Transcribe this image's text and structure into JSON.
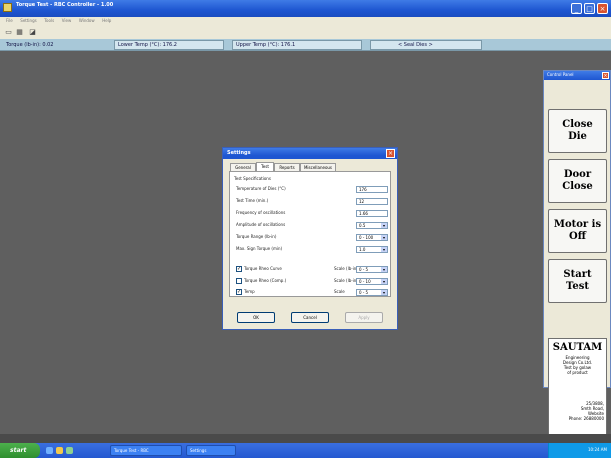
{
  "window": {
    "title": "Torque Test - RBC Controller - 1.00"
  },
  "menu": [
    "File",
    "Settings",
    "Tools",
    "View",
    "Window",
    "Help"
  ],
  "status": {
    "torque": "Torque (lb-in): 0.02",
    "lower_temp": "Lower Temp (°C): 176.2",
    "upper_temp": "Upper Temp (°C): 176.1",
    "die_state": "< Seal Dies >"
  },
  "panel": {
    "title": "Control Panel",
    "close_die": "Close\nDie",
    "door_close": "Door\nClose",
    "motor": "Motor is\nOff",
    "start_test": "Start\nTest",
    "sautam": {
      "logo": "SAUTAM",
      "subtitle": "Engineering\nDesign Co.Ltd.\nTest by golaw\nof product",
      "address": "25/3808,\nSmth Road,\nWebsite\nPhone: 26880000"
    }
  },
  "dialog": {
    "title": "Settings",
    "tabs": [
      "General",
      "Test",
      "Reports",
      "Miscellaneous"
    ],
    "group": "Test Specifications",
    "fields": [
      {
        "label": "Temperature of Dies (°C)",
        "value": "176"
      },
      {
        "label": "Test Time (min.)",
        "value": "12"
      },
      {
        "label": "Frequency of oscillations",
        "value": "1.66"
      },
      {
        "label": "Amplitude of oscillations",
        "value": "0.5"
      },
      {
        "label": "Torque Range (lb-in)",
        "value": "0 - 100"
      },
      {
        "label": "Max. Sign Torque (min)",
        "value": "1.0"
      }
    ],
    "checks": [
      {
        "label": "Torque Rheo Curve",
        "checked": "✓",
        "scale_label": "Scale (lb-in)",
        "scale": "0 - 5"
      },
      {
        "label": "Torque Rheo (Comp.)",
        "checked": "",
        "scale_label": "Scale (lb-in)",
        "scale": "0 - 10"
      },
      {
        "label": "Temp",
        "checked": "✓",
        "scale_label": "Scale",
        "scale": "0 - 5"
      }
    ],
    "buttons": {
      "ok": "OK",
      "cancel": "Cancel",
      "apply": "Apply"
    }
  },
  "taskbar": {
    "start": "start",
    "items": [
      "Torque Test - RBC",
      "Settings"
    ],
    "clock": "10:24 AM"
  }
}
